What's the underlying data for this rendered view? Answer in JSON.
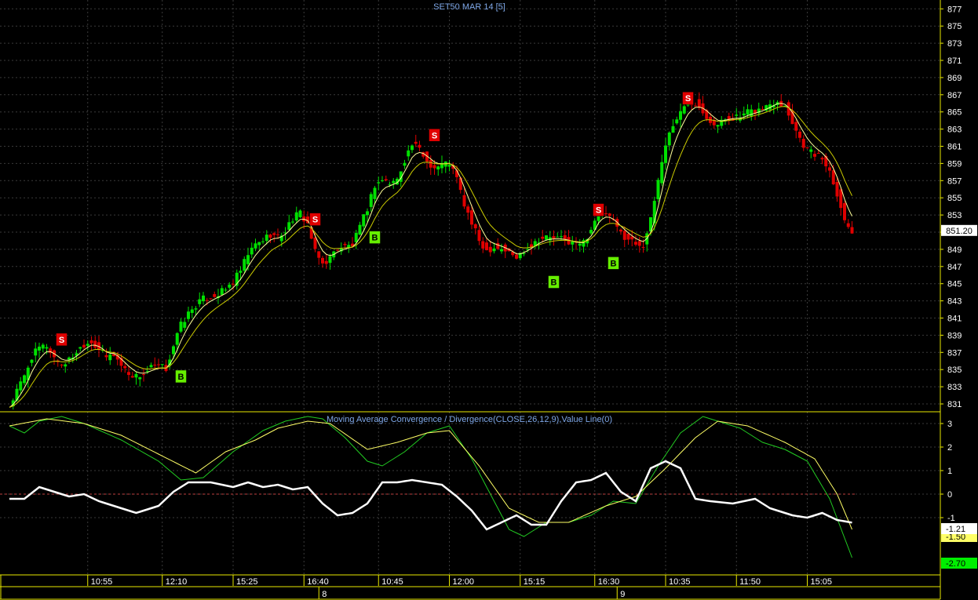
{
  "chart_data": [
    {
      "type": "candlestick",
      "title": "SET50 MAR 14   [5]",
      "ylim": [
        830,
        878
      ],
      "ticks": [
        831,
        833,
        835,
        837,
        839,
        841,
        843,
        845,
        847,
        849,
        851,
        853,
        855,
        857,
        859,
        861,
        863,
        865,
        867,
        869,
        871,
        873,
        875,
        877
      ],
      "last_price": "851.20",
      "grid": true,
      "colors": {
        "up": "#00e000",
        "down": "#e00000",
        "ma_fast": "#ffff99",
        "ma_slow": "#cccc00",
        "grid": "#3a3a3a"
      },
      "anchors": [
        [
          0,
          830.6
        ],
        [
          2,
          832.5
        ],
        [
          4,
          834.2
        ],
        [
          6,
          836.5
        ],
        [
          8,
          837.5
        ],
        [
          10,
          837.8
        ],
        [
          12,
          836.4
        ],
        [
          14,
          835.6
        ],
        [
          16,
          836.1
        ],
        [
          18,
          837.1
        ],
        [
          20,
          838.0
        ],
        [
          22,
          838.3
        ],
        [
          24,
          837.4
        ],
        [
          26,
          836.4
        ],
        [
          28,
          836.8
        ],
        [
          30,
          835.5
        ],
        [
          32,
          834.6
        ],
        [
          34,
          834.2
        ],
        [
          36,
          834.5
        ],
        [
          38,
          835.2
        ],
        [
          40,
          835.4
        ],
        [
          42,
          835.1
        ],
        [
          44,
          837.8
        ],
        [
          46,
          840.2
        ],
        [
          48,
          841.5
        ],
        [
          50,
          842.5
        ],
        [
          52,
          843.2
        ],
        [
          54,
          843.5
        ],
        [
          56,
          843.8
        ],
        [
          58,
          844.3
        ],
        [
          60,
          845.2
        ],
        [
          62,
          846.5
        ],
        [
          64,
          848.4
        ],
        [
          66,
          849.5
        ],
        [
          68,
          850.1
        ],
        [
          70,
          850.8
        ],
        [
          72,
          850.4
        ],
        [
          74,
          851.2
        ],
        [
          76,
          852.6
        ],
        [
          78,
          853.2
        ],
        [
          80,
          852.0
        ],
        [
          82,
          848.6
        ],
        [
          84,
          847.3
        ],
        [
          86,
          848.0
        ],
        [
          88,
          849.2
        ],
        [
          90,
          849.3
        ],
        [
          92,
          849.5
        ],
        [
          94,
          851.5
        ],
        [
          96,
          853.8
        ],
        [
          98,
          856.5
        ],
        [
          100,
          857.1
        ],
        [
          102,
          856.7
        ],
        [
          104,
          857.1
        ],
        [
          106,
          859.5
        ],
        [
          108,
          861.2
        ],
        [
          110,
          860.6
        ],
        [
          112,
          859.3
        ],
        [
          114,
          858.5
        ],
        [
          116,
          858.9
        ],
        [
          118,
          859.1
        ],
        [
          120,
          857.2
        ],
        [
          122,
          854.2
        ],
        [
          124,
          852.0
        ],
        [
          126,
          850.0
        ],
        [
          128,
          848.9
        ],
        [
          130,
          849.3
        ],
        [
          132,
          849.1
        ],
        [
          134,
          848.6
        ],
        [
          136,
          848.0
        ],
        [
          138,
          848.9
        ],
        [
          140,
          849.6
        ],
        [
          142,
          850.2
        ],
        [
          144,
          850.4
        ],
        [
          146,
          850.3
        ],
        [
          148,
          850.2
        ],
        [
          150,
          849.9
        ],
        [
          152,
          849.6
        ],
        [
          154,
          849.8
        ],
        [
          156,
          851.4
        ],
        [
          158,
          853.6
        ],
        [
          160,
          853.2
        ],
        [
          162,
          852.1
        ],
        [
          164,
          850.9
        ],
        [
          166,
          850.2
        ],
        [
          168,
          849.7
        ],
        [
          170,
          849.6
        ],
        [
          172,
          852.3
        ],
        [
          174,
          857.1
        ],
        [
          176,
          861.3
        ],
        [
          178,
          863.6
        ],
        [
          180,
          864.9
        ],
        [
          182,
          866.2
        ],
        [
          184,
          866.1
        ],
        [
          186,
          865.2
        ],
        [
          188,
          864.0
        ],
        [
          190,
          863.4
        ],
        [
          192,
          864.2
        ],
        [
          194,
          864.4
        ],
        [
          196,
          864.3
        ],
        [
          198,
          864.9
        ],
        [
          200,
          865.1
        ],
        [
          202,
          865.4
        ],
        [
          204,
          865.9
        ],
        [
          206,
          866.4
        ],
        [
          208,
          865.7
        ],
        [
          210,
          863.9
        ],
        [
          212,
          861.9
        ],
        [
          214,
          860.6
        ],
        [
          216,
          860.1
        ],
        [
          218,
          859.6
        ],
        [
          220,
          858.2
        ],
        [
          222,
          855.6
        ],
        [
          224,
          852.3
        ],
        [
          226,
          851.2
        ]
      ]
    },
    {
      "type": "line",
      "title": "Moving Average Convergence / Divergence(CLOSE,26,12,9),Value Line(0)",
      "ylim": [
        -3.5,
        3.6
      ],
      "ticks": [
        3,
        2,
        1,
        0,
        -1
      ],
      "value_line": 0,
      "series": [
        {
          "key": "macd",
          "color": "#22cc22",
          "last": "-2.70",
          "last_bg": "#00ee00",
          "last_fg": "#000000",
          "anchors": [
            [
              0,
              2.9
            ],
            [
              4,
              2.6
            ],
            [
              8,
              3.1
            ],
            [
              14,
              3.3
            ],
            [
              20,
              3.0
            ],
            [
              30,
              2.3
            ],
            [
              40,
              1.4
            ],
            [
              46,
              0.6
            ],
            [
              52,
              0.7
            ],
            [
              60,
              1.8
            ],
            [
              68,
              2.7
            ],
            [
              74,
              3.1
            ],
            [
              80,
              3.3
            ],
            [
              84,
              3.2
            ],
            [
              90,
              2.4
            ],
            [
              96,
              1.4
            ],
            [
              100,
              1.2
            ],
            [
              106,
              1.8
            ],
            [
              112,
              2.6
            ],
            [
              118,
              2.9
            ],
            [
              124,
              1.5
            ],
            [
              130,
              -0.3
            ],
            [
              134,
              -1.5
            ],
            [
              138,
              -1.8
            ],
            [
              144,
              -1.2
            ],
            [
              150,
              -1.2
            ],
            [
              156,
              -0.9
            ],
            [
              162,
              -0.3
            ],
            [
              168,
              -0.4
            ],
            [
              174,
              1.2
            ],
            [
              180,
              2.6
            ],
            [
              186,
              3.3
            ],
            [
              190,
              3.1
            ],
            [
              196,
              2.8
            ],
            [
              202,
              2.2
            ],
            [
              208,
              1.9
            ],
            [
              214,
              1.4
            ],
            [
              220,
              -0.2
            ],
            [
              226,
              -2.7
            ]
          ]
        },
        {
          "key": "signal",
          "color": "#ffff66",
          "last": "-1.50",
          "last_bg": "#ffff66",
          "last_fg": "#000000",
          "anchors": [
            [
              0,
              2.9
            ],
            [
              10,
              3.2
            ],
            [
              20,
              3.0
            ],
            [
              30,
              2.5
            ],
            [
              40,
              1.7
            ],
            [
              50,
              0.9
            ],
            [
              58,
              1.8
            ],
            [
              66,
              2.3
            ],
            [
              72,
              2.8
            ],
            [
              80,
              3.1
            ],
            [
              86,
              3.0
            ],
            [
              96,
              1.9
            ],
            [
              104,
              2.2
            ],
            [
              112,
              2.6
            ],
            [
              118,
              2.7
            ],
            [
              126,
              1.2
            ],
            [
              134,
              -0.6
            ],
            [
              142,
              -1.2
            ],
            [
              150,
              -1.2
            ],
            [
              160,
              -0.5
            ],
            [
              168,
              -0.1
            ],
            [
              176,
              1.1
            ],
            [
              184,
              2.4
            ],
            [
              190,
              3.1
            ],
            [
              198,
              2.9
            ],
            [
              208,
              2.2
            ],
            [
              216,
              1.5
            ],
            [
              222,
              0.0
            ],
            [
              226,
              -1.5
            ]
          ]
        },
        {
          "key": "histogram",
          "color": "#ffffff",
          "width": 2.5,
          "last": "-1.21",
          "last_bg": "#ffffff",
          "last_fg": "#000000",
          "anchors": [
            [
              0,
              -0.2
            ],
            [
              4,
              -0.2
            ],
            [
              8,
              0.3
            ],
            [
              12,
              0.1
            ],
            [
              16,
              -0.1
            ],
            [
              20,
              0.0
            ],
            [
              24,
              -0.3
            ],
            [
              28,
              -0.5
            ],
            [
              34,
              -0.8
            ],
            [
              40,
              -0.5
            ],
            [
              44,
              0.1
            ],
            [
              48,
              0.5
            ],
            [
              54,
              0.5
            ],
            [
              60,
              0.3
            ],
            [
              64,
              0.5
            ],
            [
              68,
              0.3
            ],
            [
              72,
              0.4
            ],
            [
              76,
              0.2
            ],
            [
              80,
              0.3
            ],
            [
              84,
              -0.4
            ],
            [
              88,
              -0.9
            ],
            [
              92,
              -0.8
            ],
            [
              96,
              -0.4
            ],
            [
              100,
              0.5
            ],
            [
              104,
              0.5
            ],
            [
              108,
              0.6
            ],
            [
              112,
              0.5
            ],
            [
              116,
              0.4
            ],
            [
              120,
              -0.1
            ],
            [
              124,
              -0.7
            ],
            [
              128,
              -1.5
            ],
            [
              132,
              -1.2
            ],
            [
              136,
              -0.9
            ],
            [
              140,
              -1.3
            ],
            [
              144,
              -1.3
            ],
            [
              148,
              -0.3
            ],
            [
              152,
              0.5
            ],
            [
              156,
              0.6
            ],
            [
              160,
              0.9
            ],
            [
              164,
              0.1
            ],
            [
              168,
              -0.3
            ],
            [
              172,
              1.1
            ],
            [
              176,
              1.4
            ],
            [
              180,
              1.1
            ],
            [
              184,
              -0.2
            ],
            [
              188,
              -0.3
            ],
            [
              194,
              -0.4
            ],
            [
              200,
              -0.2
            ],
            [
              204,
              -0.6
            ],
            [
              210,
              -0.9
            ],
            [
              214,
              -1.0
            ],
            [
              218,
              -0.8
            ],
            [
              222,
              -1.1
            ],
            [
              226,
              -1.21
            ]
          ]
        }
      ]
    }
  ],
  "signals": [
    {
      "type": "S",
      "bar": 14,
      "price": 838.5
    },
    {
      "type": "B",
      "bar": 46,
      "price": 834.2
    },
    {
      "type": "S",
      "bar": 82,
      "price": 852.5
    },
    {
      "type": "B",
      "bar": 98,
      "price": 850.4
    },
    {
      "type": "S",
      "bar": 114,
      "price": 862.3
    },
    {
      "type": "B",
      "bar": 146,
      "price": 845.2
    },
    {
      "type": "S",
      "bar": 158,
      "price": 853.6
    },
    {
      "type": "B",
      "bar": 162,
      "price": 847.4
    },
    {
      "type": "S",
      "bar": 182,
      "price": 866.6
    }
  ],
  "time_axis": {
    "labels": [
      {
        "text": "10:55",
        "bar": 21
      },
      {
        "text": "12:10",
        "bar": 41
      },
      {
        "text": "15:25",
        "bar": 60
      },
      {
        "text": "16:40",
        "bar": 79
      },
      {
        "text": "10:45",
        "bar": 99
      },
      {
        "text": "12:00",
        "bar": 118
      },
      {
        "text": "15:15",
        "bar": 137
      },
      {
        "text": "16:30",
        "bar": 157
      },
      {
        "text": "10:35",
        "bar": 176
      },
      {
        "text": "11:50",
        "bar": 195
      },
      {
        "text": "15:05",
        "bar": 214
      }
    ],
    "day_labels": [
      {
        "text": "8",
        "bar": 83
      },
      {
        "text": "9",
        "bar": 163
      }
    ]
  }
}
